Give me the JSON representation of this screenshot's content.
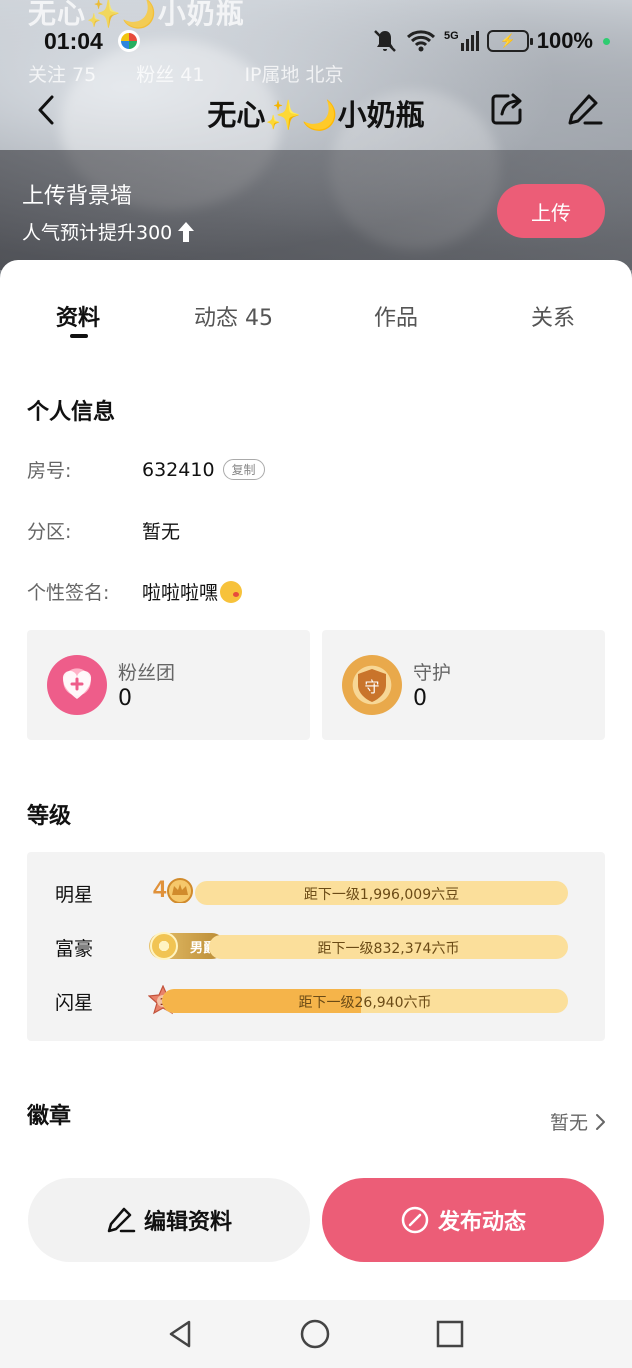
{
  "header": {
    "ghost_name": "无心✨🌙小奶瓶",
    "ghost_stats": [
      "关注 75",
      "粉丝 41",
      "IP属地 北京"
    ]
  },
  "status_bar": {
    "time": "01:04",
    "battery": "100%",
    "network": "5G"
  },
  "nav": {
    "title": "无心✨🌙小奶瓶"
  },
  "upload_banner": {
    "title": "上传背景墙",
    "subtitle": "人气预计提升300",
    "button": "上传"
  },
  "tabs": [
    {
      "label": "资料",
      "active": true
    },
    {
      "label": "动态 45",
      "active": false
    },
    {
      "label": "作品",
      "active": false
    },
    {
      "label": "关系",
      "active": false
    }
  ],
  "personal_info": {
    "title": "个人信息",
    "room_label": "房号:",
    "room_value": "632410",
    "copy_label": "复制",
    "zone_label": "分区:",
    "zone_value": "暂无",
    "sign_label": "个性签名:",
    "sign_value": "啦啦啦嘿"
  },
  "fan_club": {
    "label": "粉丝团",
    "value": "0"
  },
  "guard": {
    "label": "守护",
    "value": "0",
    "icon_text": "守"
  },
  "levels": {
    "title": "等级",
    "rows": [
      {
        "name": "明星",
        "badge": "4",
        "text": "距下一级1,996,009六豆",
        "progress": 0.0
      },
      {
        "name": "富豪",
        "badge": "男爵",
        "text": "距下一级832,374六币",
        "progress": 0.0
      },
      {
        "name": "闪星",
        "badge": "1",
        "text": "距下一级26,940六币",
        "progress": 0.49
      }
    ]
  },
  "badges": {
    "title": "徽章",
    "value": "暂无"
  },
  "actions": {
    "edit": "编辑资料",
    "post": "发布动态"
  },
  "colors": {
    "accent": "#ec5d77",
    "bar_bg": "#fbdf9b",
    "bar_fill": "#f5b44a"
  }
}
